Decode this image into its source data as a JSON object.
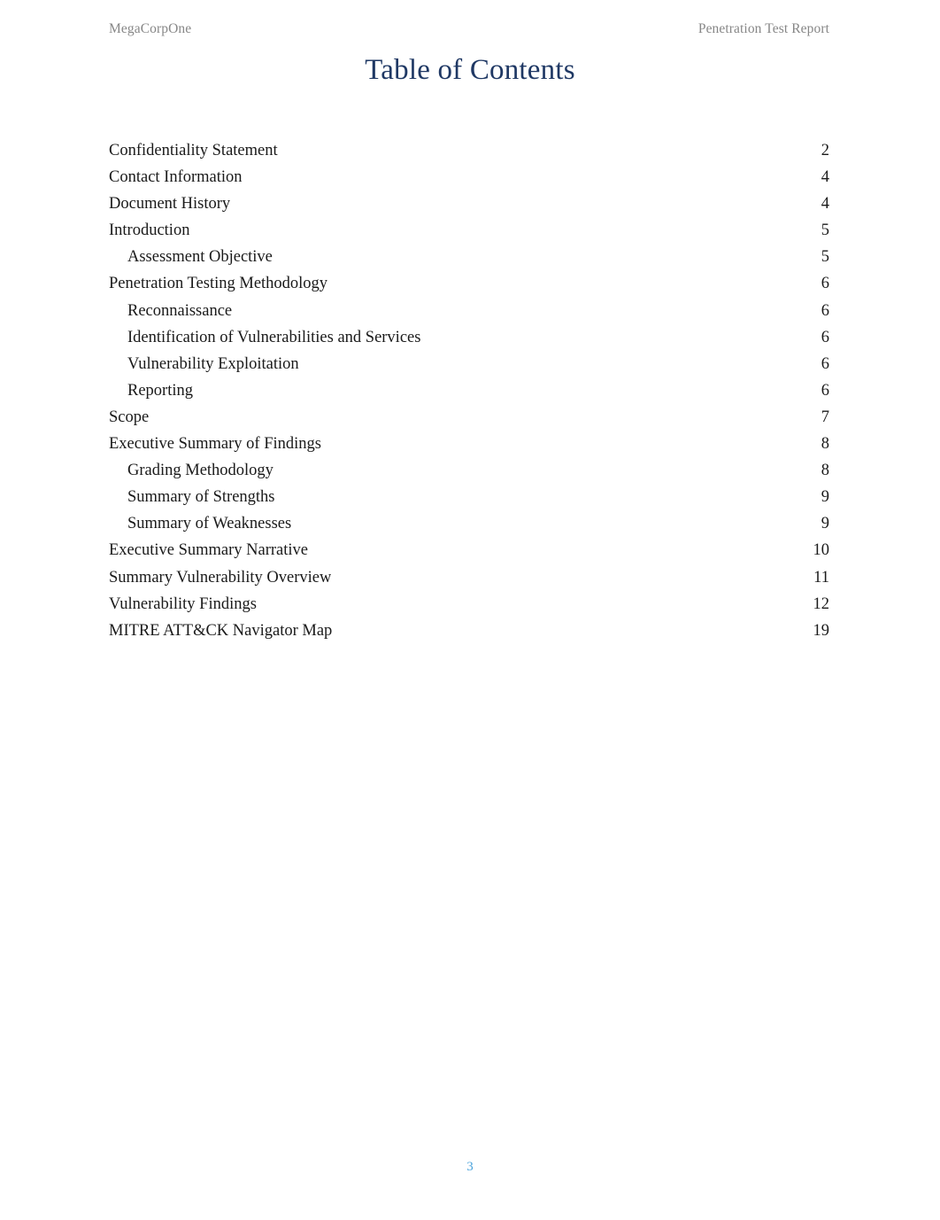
{
  "header": {
    "left": "MegaCorpOne",
    "right": "Penetration Test Report"
  },
  "title": "Table of Contents",
  "toc": {
    "entries": [
      {
        "label": "Confidentiality Statement",
        "page": "2",
        "level": 1
      },
      {
        "label": "Contact Information",
        "page": "4",
        "level": 1
      },
      {
        "label": "Document History",
        "page": "4",
        "level": 1
      },
      {
        "label": "Introduction",
        "page": "5",
        "level": 1
      },
      {
        "label": "Assessment Objective",
        "page": "5",
        "level": 2
      },
      {
        "label": "Penetration Testing Methodology",
        "page": "6",
        "level": 1
      },
      {
        "label": "Reconnaissance",
        "page": "6",
        "level": 2
      },
      {
        "label": "Identification of Vulnerabilities and Services",
        "page": "6",
        "level": 2
      },
      {
        "label": "Vulnerability Exploitation",
        "page": "6",
        "level": 2
      },
      {
        "label": "Reporting",
        "page": "6",
        "level": 2
      },
      {
        "label": "Scope",
        "page": "7",
        "level": 1
      },
      {
        "label": "Executive Summary of Findings",
        "page": "8",
        "level": 1
      },
      {
        "label": "Grading Methodology",
        "page": "8",
        "level": 2
      },
      {
        "label": "Summary of Strengths",
        "page": "9",
        "level": 2
      },
      {
        "label": "Summary of Weaknesses",
        "page": "9",
        "level": 2
      },
      {
        "label": "Executive Summary Narrative",
        "page": "10",
        "level": 1
      },
      {
        "label": "Summary Vulnerability Overview",
        "page": "11",
        "level": 1
      },
      {
        "label": "Vulnerability Findings",
        "page": "12",
        "level": 1
      },
      {
        "label": "MITRE ATT&CK Navigator Map",
        "page": "19",
        "level": 1
      }
    ]
  },
  "footer": {
    "page_number": "3"
  },
  "colors": {
    "title": "#1f3864",
    "header_text": "#878787",
    "body_text": "#1a1a1a",
    "footer_number": "#4ba3dc",
    "background": "#ffffff"
  }
}
